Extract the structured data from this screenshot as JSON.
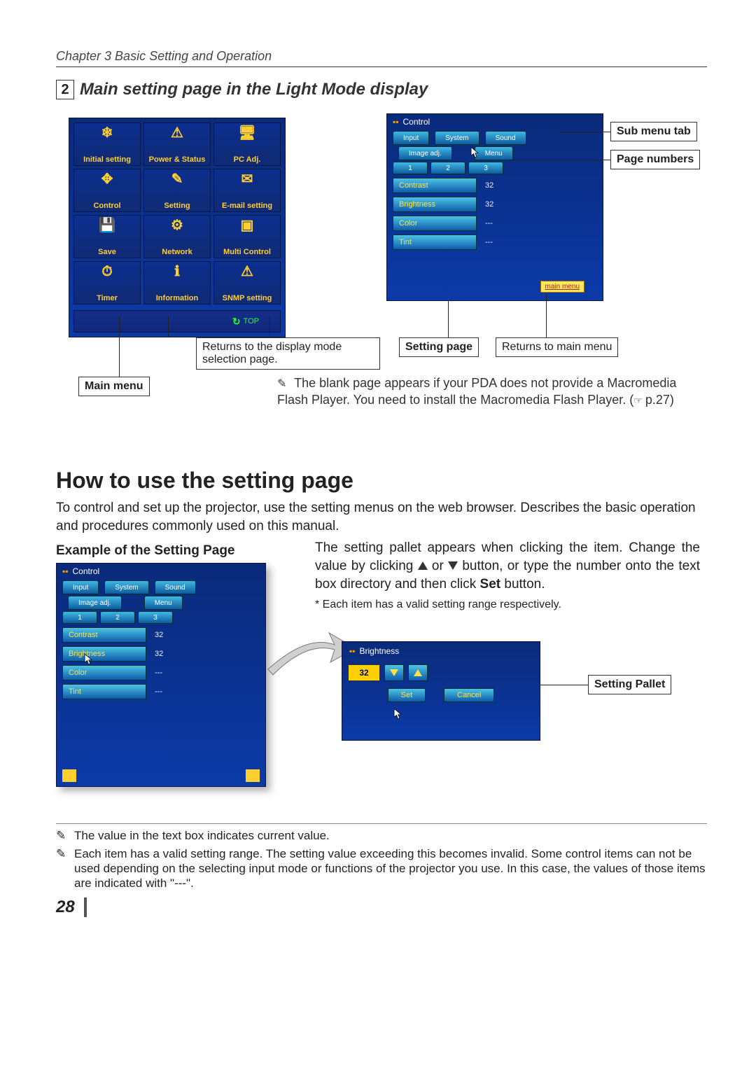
{
  "header": {
    "chapter": "Chapter 3 Basic Setting and Operation"
  },
  "section1": {
    "number": "2",
    "title": "Main setting page in the Light Mode display"
  },
  "mainmenu": {
    "cells": [
      {
        "icon": "❄",
        "label": "Initial setting"
      },
      {
        "icon": "⚠",
        "label": "Power & Status"
      },
      {
        "icon": "🖥",
        "label": "PC Adj."
      },
      {
        "icon": "✥",
        "label": "Control"
      },
      {
        "icon": "✎",
        "label": "Setting"
      },
      {
        "icon": "✉",
        "label": "E-mail setting"
      },
      {
        "icon": "💾",
        "label": "Save"
      },
      {
        "icon": "⚙",
        "label": "Network"
      },
      {
        "icon": "▣",
        "label": "Multi Control"
      },
      {
        "icon": "⏱",
        "label": "Timer"
      },
      {
        "icon": "ℹ",
        "label": "Information"
      },
      {
        "icon": "⚠",
        "label": "SNMP setting"
      }
    ],
    "top_link": "TOP"
  },
  "controlwin": {
    "title": "Control",
    "tabs1": [
      "Input",
      "System",
      "Sound"
    ],
    "tabs2": [
      "Image adj.",
      "Menu"
    ],
    "pages": [
      "1",
      "2",
      "3"
    ],
    "rows": [
      {
        "label": "Contrast",
        "value": "32"
      },
      {
        "label": "Brightness",
        "value": "32"
      },
      {
        "label": "Color",
        "value": "---"
      },
      {
        "label": "Tint",
        "value": "---"
      }
    ],
    "mainmenu_btn": "main menu"
  },
  "annot": {
    "sub_menu_tab": "Sub menu tab",
    "page_numbers": "Page numbers",
    "returns_top": "Returns to the display mode selection page.",
    "setting_page": "Setting page",
    "returns_main": "Returns to main menu",
    "main_menu": "Main menu",
    "pda_note": "The blank page appears if your PDA does not provide a Macromedia Flash Player. You need to install the Macromedia Flash Player. (",
    "pda_note_ref": "p.27)"
  },
  "section2": {
    "title": "How to use the setting page",
    "para": "To control and set up the projector, use the setting menus on the web browser. Describes the basic operation and procedures commonly used on this manual.",
    "example_title": "Example of the Setting Page",
    "desc1": "The setting pallet appears when clicking the item. Change the value by clicking ",
    "desc2": " or ",
    "desc3": " button, or type the number onto the text box directory and then click ",
    "set_word": "Set",
    "desc4": " button.",
    "footnote_small": "* Each item has a valid setting range respectively."
  },
  "pallet": {
    "title": "Brightness",
    "value": "32",
    "set": "Set",
    "cancel": "Cancel",
    "label": "Setting Pallet"
  },
  "footnotes": [
    "The value in the text box indicates current value.",
    "Each item has a valid setting range. The setting value exceeding this becomes invalid. Some control items can not be used depending on the selecting input mode or functions of the projector you use. In this case, the values of those items are indicated with \"---\"."
  ],
  "page_number": "28"
}
